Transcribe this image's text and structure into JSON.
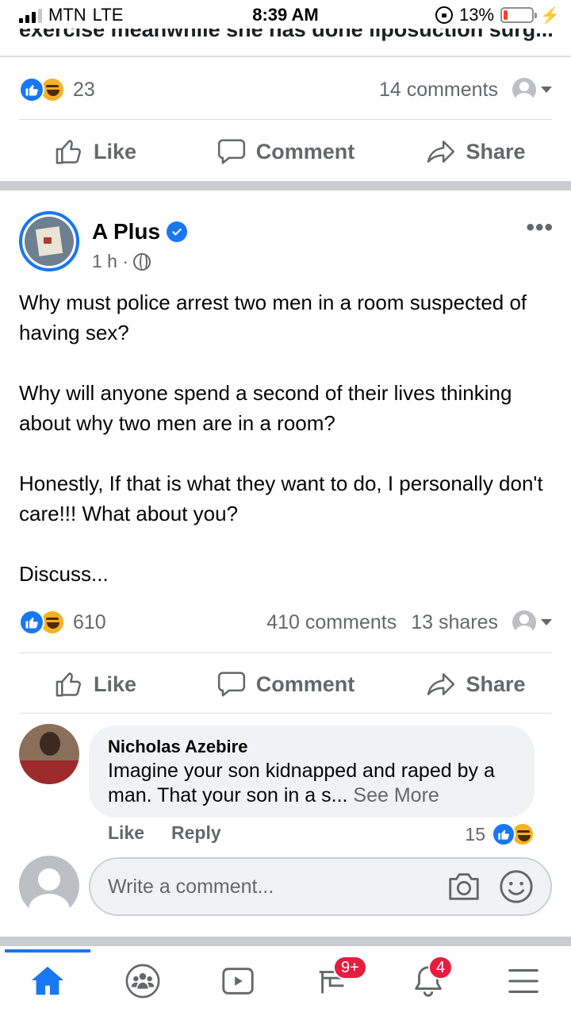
{
  "status_bar": {
    "carrier": "MTN",
    "network": "LTE",
    "time": "8:39 AM",
    "battery": "13%",
    "battery_level": 0.13
  },
  "previous_post": {
    "text_snippet": "exercise meanwhile she has done liposuction surg...",
    "reaction_count": "23",
    "comments": "14 comments",
    "actions": {
      "like": "Like",
      "comment": "Comment",
      "share": "Share"
    }
  },
  "post": {
    "author": "A Plus",
    "verified": true,
    "time": "1 h ·",
    "paragraphs": [
      "Why must police arrest two men in a room suspected of having sex?",
      "Why will anyone spend a second of their lives thinking about why two men are in a room?",
      "Honestly, If that is what they want to do, I personally don't care!!! What about you?",
      "Discuss..."
    ],
    "reaction_count": "610",
    "comments": "410 comments",
    "shares": "13 shares",
    "actions": {
      "like": "Like",
      "comment": "Comment",
      "share": "Share"
    }
  },
  "comment": {
    "author": "Nicholas Azebire",
    "text": "Imagine your son kidnapped and raped by a man. That your son in a s...",
    "see_more": "See More",
    "like": "Like",
    "reply": "Reply",
    "reaction_count": "15"
  },
  "composer": {
    "placeholder": "Write a comment..."
  },
  "tabbar": {
    "tabs": [
      "home",
      "groups",
      "watch",
      "marketplace",
      "notifications",
      "menu"
    ],
    "active": "home",
    "marketplace_badge": "9+",
    "notifications_badge": "4"
  },
  "colors": {
    "brand": "#1877f2",
    "badge": "#e41e3f",
    "muted": "#65676b"
  }
}
